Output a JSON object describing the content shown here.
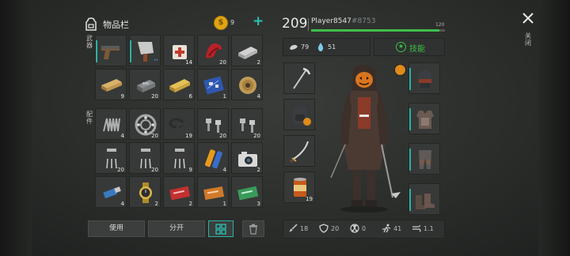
{
  "inventory": {
    "title": "物品栏",
    "coins": "9",
    "plus_label": "+",
    "side_label_top": "武器",
    "side_label_bottom": "配件",
    "use_button": "使用",
    "split_button": "分开"
  },
  "weapon_slots": [
    {
      "icon": "pistol-icon",
      "count": ""
    },
    {
      "icon": "cleaver-icon",
      "count": ""
    },
    {
      "icon": "medkit-icon",
      "count": "14"
    },
    {
      "icon": "red-cloth-icon",
      "count": "20"
    },
    {
      "icon": "metal-bar-icon",
      "count": "2"
    },
    {
      "icon": "wood-plank-icon",
      "count": "9"
    },
    {
      "icon": "iron-ingot-icon",
      "count": "20"
    },
    {
      "icon": "gold-plank-icon",
      "count": "6"
    },
    {
      "icon": "circuit-board-icon",
      "count": "1"
    },
    {
      "icon": "wire-spool-icon",
      "count": "4"
    }
  ],
  "parts_slots": [
    {
      "icon": "spring-icon",
      "count": "4"
    },
    {
      "icon": "bearing-icon",
      "count": "20"
    },
    {
      "icon": "rubber-ring-icon",
      "count": "19"
    },
    {
      "icon": "bolts-icon",
      "count": "20"
    },
    {
      "icon": "bolts-icon",
      "count": "20"
    },
    {
      "icon": "transistor-icon",
      "count": "20"
    },
    {
      "icon": "transistor-icon",
      "count": "20"
    },
    {
      "icon": "transistor-icon",
      "count": "9"
    },
    {
      "icon": "batteries-icon",
      "count": "4"
    },
    {
      "icon": "camera-icon",
      "count": "2"
    },
    {
      "icon": "usb-stick-icon",
      "count": "4"
    },
    {
      "icon": "watch-icon",
      "count": "2"
    },
    {
      "icon": "red-ticket-icon",
      "count": "2"
    },
    {
      "icon": "orange-ticket-icon",
      "count": "1"
    },
    {
      "icon": "green-ticket-icon",
      "count": "3"
    }
  ],
  "player": {
    "level": "209",
    "name": "Player8547",
    "tag": "#8753",
    "xp_max": "120",
    "xp_fraction": 0.96,
    "food": "79",
    "water": "51",
    "skills_label": "技能"
  },
  "equipment": {
    "left": [
      {
        "icon": "pickaxe-icon",
        "count": ""
      },
      {
        "icon": "backpack-icon",
        "count": ""
      },
      {
        "icon": "katana-icon",
        "count": ""
      },
      {
        "icon": "canned-food-icon",
        "count": "19"
      }
    ],
    "right": [
      {
        "icon": "helmet-icon"
      },
      {
        "icon": "armor-vest-icon"
      },
      {
        "icon": "armor-pants-icon"
      },
      {
        "icon": "boots-icon"
      }
    ]
  },
  "stats": {
    "attack": "18",
    "defense": "20",
    "radiation": "0",
    "speed": "41",
    "modifier": "1.1"
  },
  "close": {
    "icon": "close-icon",
    "label": "关闭"
  },
  "colors": {
    "accent": "#2bb2a6",
    "xp_bar": "#3fbf4a",
    "coin": "#e0a514",
    "plus": "#2bc4b4"
  }
}
